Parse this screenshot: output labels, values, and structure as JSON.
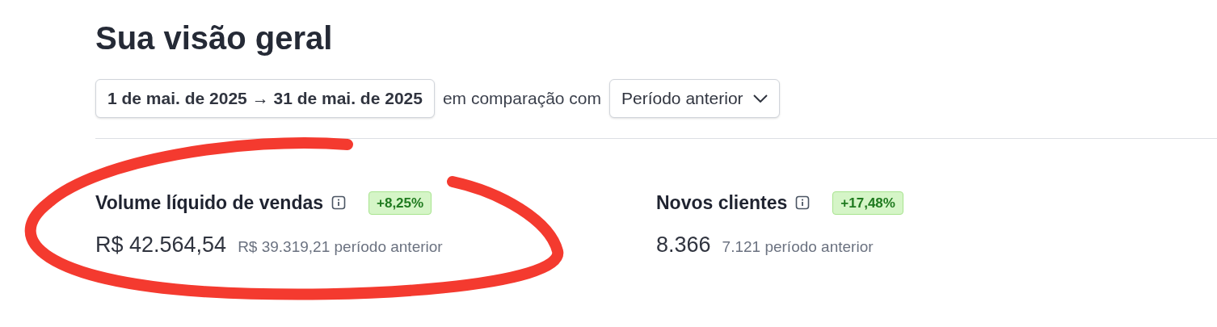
{
  "title": "Sua visão geral",
  "date_range": {
    "start": "1 de mai. de 2025",
    "arrow": "→",
    "end": "31 de mai. de 2025"
  },
  "comparison_label": "em comparação com",
  "comparison_select": {
    "value": "Período anterior"
  },
  "metrics": [
    {
      "label": "Volume líquido de vendas",
      "change": "+8,25%",
      "value": "R$ 42.564,54",
      "previous": "R$ 39.319,21 período anterior",
      "highlighted": true
    },
    {
      "label": "Novos clientes",
      "change": "+17,48%",
      "value": "8.366",
      "previous": "7.121 período anterior",
      "highlighted": false
    }
  ]
}
